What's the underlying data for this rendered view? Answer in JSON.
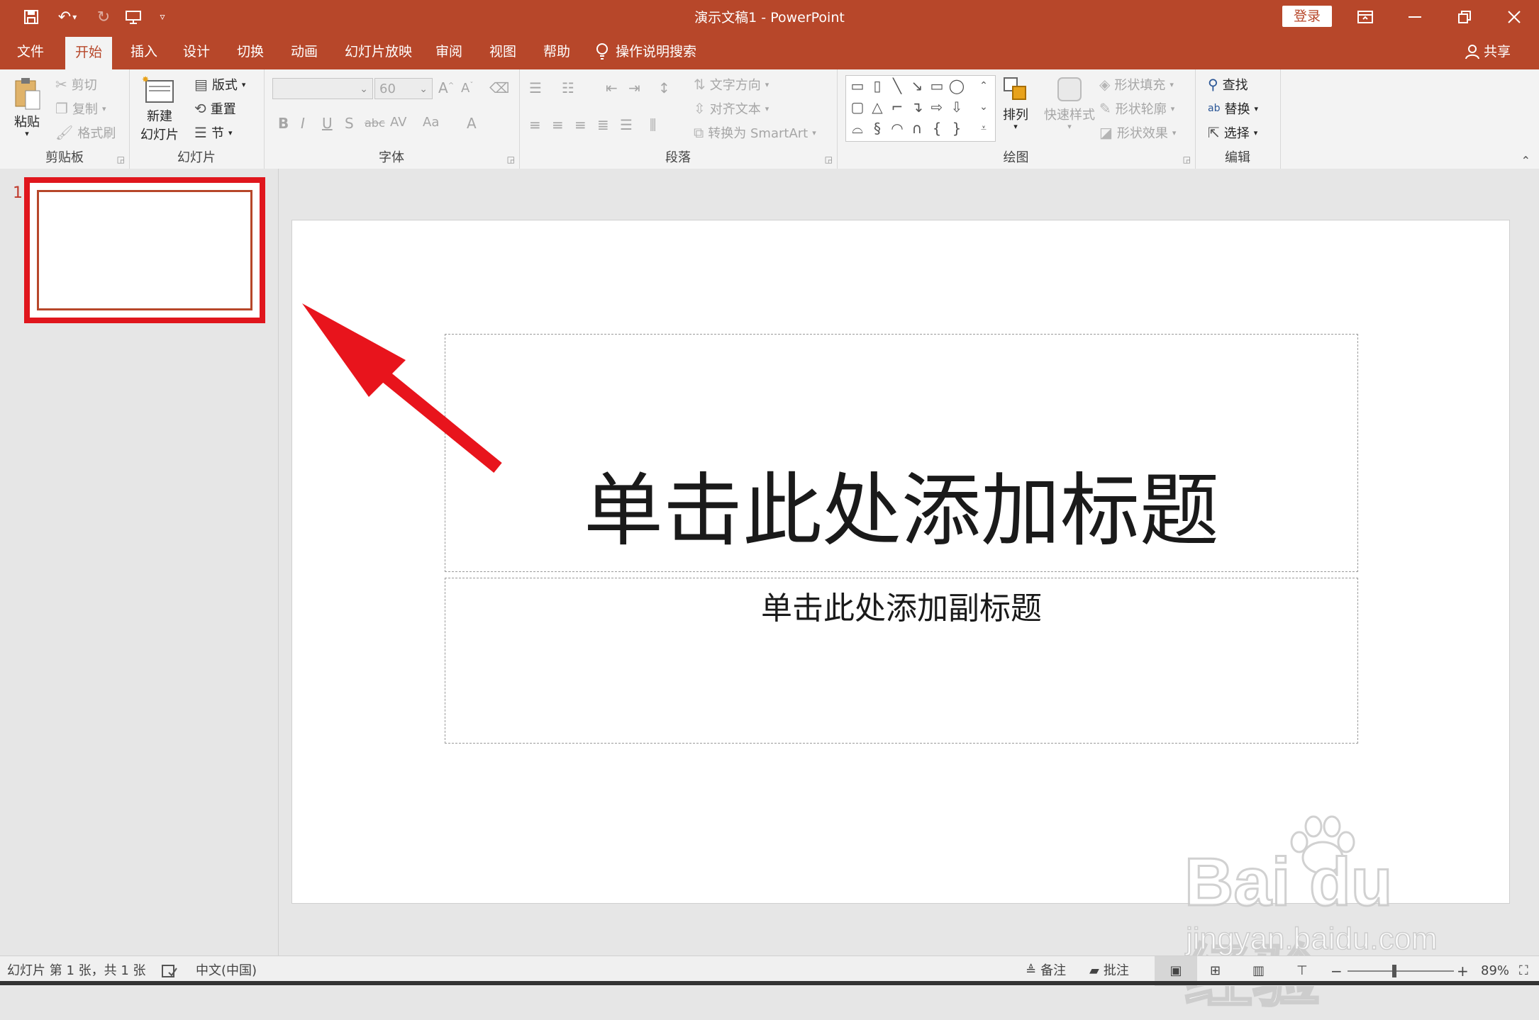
{
  "window": {
    "title": "演示文稿1  -  PowerPoint",
    "login_label": "登录",
    "qat_icons": [
      "save-icon",
      "undo-icon",
      "redo-icon",
      "present-from-start-icon",
      "customize-qat-icon"
    ]
  },
  "tabs": [
    "文件",
    "开始",
    "插入",
    "设计",
    "切换",
    "动画",
    "幻灯片放映",
    "审阅",
    "视图",
    "帮助"
  ],
  "active_tab": "开始",
  "tell_me": "操作说明搜索",
  "share": "共享",
  "ribbon": {
    "clipboard": {
      "label": "剪贴板",
      "paste": "粘贴",
      "cut": "剪切",
      "copy": "复制",
      "format_painter": "格式刷"
    },
    "slides": {
      "label": "幻灯片",
      "new_slide_1": "新建",
      "new_slide_2": "幻灯片",
      "layout": "版式",
      "reset": "重置",
      "section": "节"
    },
    "font": {
      "label": "字体",
      "font_name": "",
      "font_size": "60",
      "bold": "B",
      "italic": "I",
      "underline": "U",
      "shadow": "S",
      "strike": "abc",
      "spacing": "AV",
      "case": "Aa",
      "color": "A"
    },
    "paragraph": {
      "label": "段落",
      "text_direction": "文字方向",
      "align_text": "对齐文本",
      "smartart": "转换为 SmartArt"
    },
    "drawing": {
      "label": "绘图",
      "arrange": "排列",
      "quick_styles": "快速样式",
      "shape_fill": "形状填充",
      "shape_outline": "形状轮廓",
      "shape_effects": "形状效果"
    },
    "editing": {
      "label": "编辑",
      "find": "查找",
      "replace": "替换",
      "select": "选择"
    }
  },
  "thumbnail": {
    "number": "1"
  },
  "slide": {
    "title_placeholder": "单击此处添加标题",
    "subtitle_placeholder": "单击此处添加副标题"
  },
  "watermark": {
    "logo": "Bai du 经验",
    "url": "jingyan.baidu.com"
  },
  "status": {
    "slide_info": "幻灯片 第 1 张，共 1 张",
    "language": "中文(中国)",
    "notes": "备注",
    "comments": "批注",
    "zoom": "89%",
    "zoom_value": 0.89
  }
}
